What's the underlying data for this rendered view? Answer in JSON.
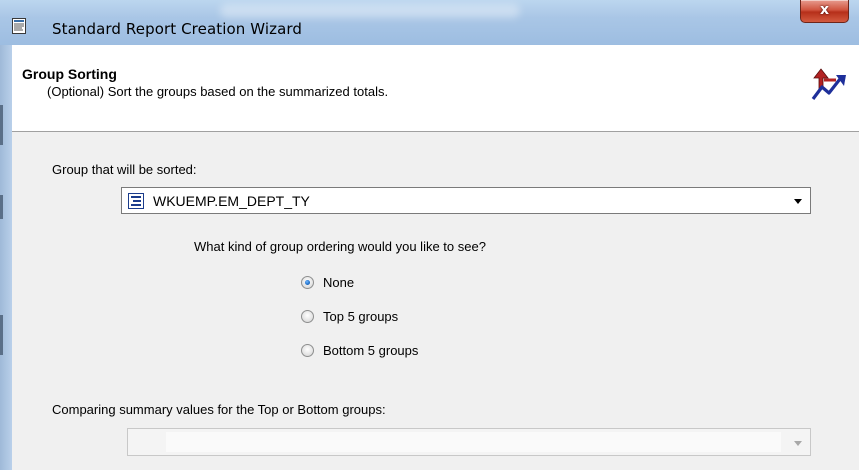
{
  "window": {
    "title": "Standard Report Creation Wizard",
    "close_label": "x"
  },
  "header": {
    "title": "Group Sorting",
    "subtitle": "(Optional) Sort the groups based on the summarized totals."
  },
  "form": {
    "group_label": "Group that will be sorted:",
    "group_value": "WKUEMP.EM_DEPT_TY",
    "ordering_question": "What kind of group ordering would you like to see?",
    "options": [
      {
        "label": "None",
        "checked": true
      },
      {
        "label": "Top 5 groups",
        "checked": false
      },
      {
        "label": "Bottom 5 groups",
        "checked": false
      }
    ],
    "compare_label": "Comparing summary values for the Top or Bottom groups:",
    "compare_value": ""
  },
  "colors": {
    "titlebar": "#a9c6e6",
    "close_button": "#c9432d",
    "radio_selected": "#1e6fc7"
  },
  "icons": {
    "app": "wizard-document-icon",
    "header": "sort-arrows-icon",
    "group_field": "group-field-icon"
  }
}
